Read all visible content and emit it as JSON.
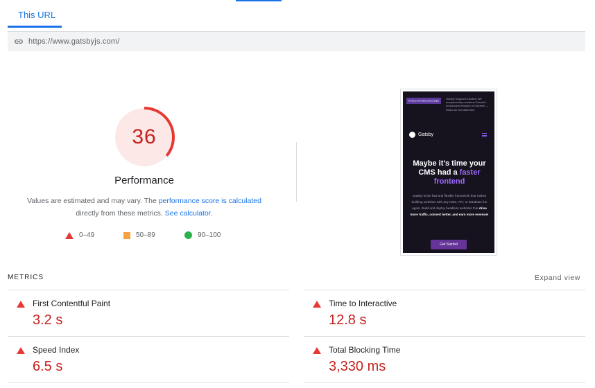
{
  "tab": {
    "label": "This URL"
  },
  "url": {
    "text": "https://www.gatsbyjs.com/",
    "icon": "link-icon"
  },
  "performance": {
    "score": "36",
    "score_value": 36,
    "title": "Performance",
    "desc_1": "Values are estimated and may vary. The ",
    "desc_link_1": "performance score is calculated",
    "desc_2": "directly from these metrics. ",
    "desc_link_2": "See calculator",
    "desc_3": ".",
    "colors": {
      "fail": "#e53935",
      "average": "#f4a340",
      "pass": "#2bb24c"
    }
  },
  "legend": [
    {
      "range": "0–49",
      "icon": "triangle-icon"
    },
    {
      "range": "50–89",
      "icon": "square-icon"
    },
    {
      "range": "90–100",
      "icon": "circle-icon"
    }
  ],
  "screenshot": {
    "banner_tag": "#TECHFORUKRAINE",
    "banner_text": "Gatsby Supports Ukraine We unequivocally condemn Russia's unprovoked invasion of Ukraine — Read our full statement",
    "logo": "Gatsby",
    "headline_1": "Maybe it's time your CMS had a ",
    "headline_accent": "faster frontend",
    "body_1": "Gatsby is the fast and flexible framework that makes building websites with any CMS, API, or database fun again. Build and deploy headless websites that ",
    "body_bold": "drive more traffic, convert better, and earn more revenue!",
    "button": "Get Started"
  },
  "metrics": {
    "label": "METRICS",
    "expand": "Expand view",
    "items": [
      {
        "title": "First Contentful Paint",
        "value": "3.2 s"
      },
      {
        "title": "Time to Interactive",
        "value": "12.8 s"
      },
      {
        "title": "Speed Index",
        "value": "6.5 s"
      },
      {
        "title": "Total Blocking Time",
        "value": "3,330 ms"
      }
    ]
  }
}
